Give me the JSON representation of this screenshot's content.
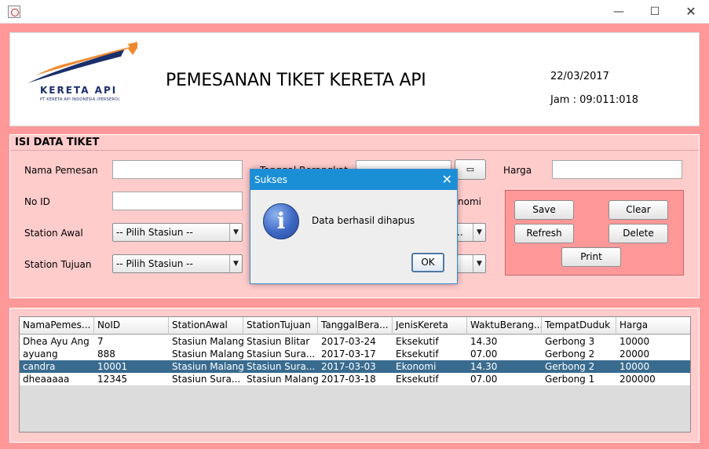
{
  "window": {
    "minimize_glyph": "—",
    "maximize_glyph": "☐",
    "close_glyph": "✕"
  },
  "header": {
    "logo_text": "KERETA API",
    "logo_subtext": "PT KERETA API INDONESIA (PERSERO)",
    "title": "PEMESANAN TIKET KERETA API",
    "date": "22/03/2017",
    "time": "Jam : 09:011:018"
  },
  "form": {
    "legend": "ISI DATA TIKET",
    "nama_pemesan_label": "Nama Pemesan",
    "nama_pemesan_value": "",
    "no_id_label": "No ID",
    "no_id_value": "",
    "station_awal_label": "Station Awal",
    "station_awal_value": "-- Pilih Stasiun --",
    "station_tujuan_label": "Station Tujuan",
    "station_tujuan_value": "-- Pilih Stasiun --",
    "tanggal_label": "Tanggal Berangkat",
    "jenis_partial": "nomi",
    "combo_partial": "..",
    "harga_label": "Harga",
    "harga_value": ""
  },
  "buttons": {
    "save": "Save",
    "clear": "Clear",
    "refresh": "Refresh",
    "delete": "Delete",
    "print": "Print"
  },
  "table": {
    "columns": [
      "NamaPemes...",
      "NoID",
      "StationAwal",
      "StationTujuan",
      "TanggalBera...",
      "JenisKereta",
      "WaktuBerang...",
      "TempatDuduk",
      "Harga"
    ],
    "rows": [
      [
        "Dhea Ayu Ang",
        "7",
        "Stasiun Malang",
        "Stasiun Blitar",
        "2017-03-24",
        "Eksekutif",
        "14.30",
        "Gerbong 3",
        "10000"
      ],
      [
        "ayuang",
        "888",
        "Stasiun Malang",
        "Stasiun Sura...",
        "2017-03-17",
        "Eksekutif",
        "07.00",
        "Gerbong 2",
        "20000"
      ],
      [
        "candra",
        "10001",
        "Stasiun Malang",
        "Stasiun Sura...",
        "2017-03-03",
        "Ekonomi",
        "14.30",
        "Gerbong 2",
        "10000"
      ],
      [
        "dheaaaaa",
        "12345",
        "Stasiun Sura...",
        "Stasiun Malang",
        "2017-03-18",
        "Eksekutif",
        "07.00",
        "Gerbong 1",
        "200000"
      ]
    ],
    "selected_row": 2
  },
  "dialog": {
    "title": "Sukses",
    "close_glyph": "✕",
    "message": "Data berhasil dihapus",
    "ok_label": "OK",
    "icon_glyph": "i"
  },
  "colors": {
    "background": "#ff9999",
    "form_panel": "#ffcccc",
    "selected_row": "#396b8f",
    "dialog_title": "#1b8fd6"
  }
}
